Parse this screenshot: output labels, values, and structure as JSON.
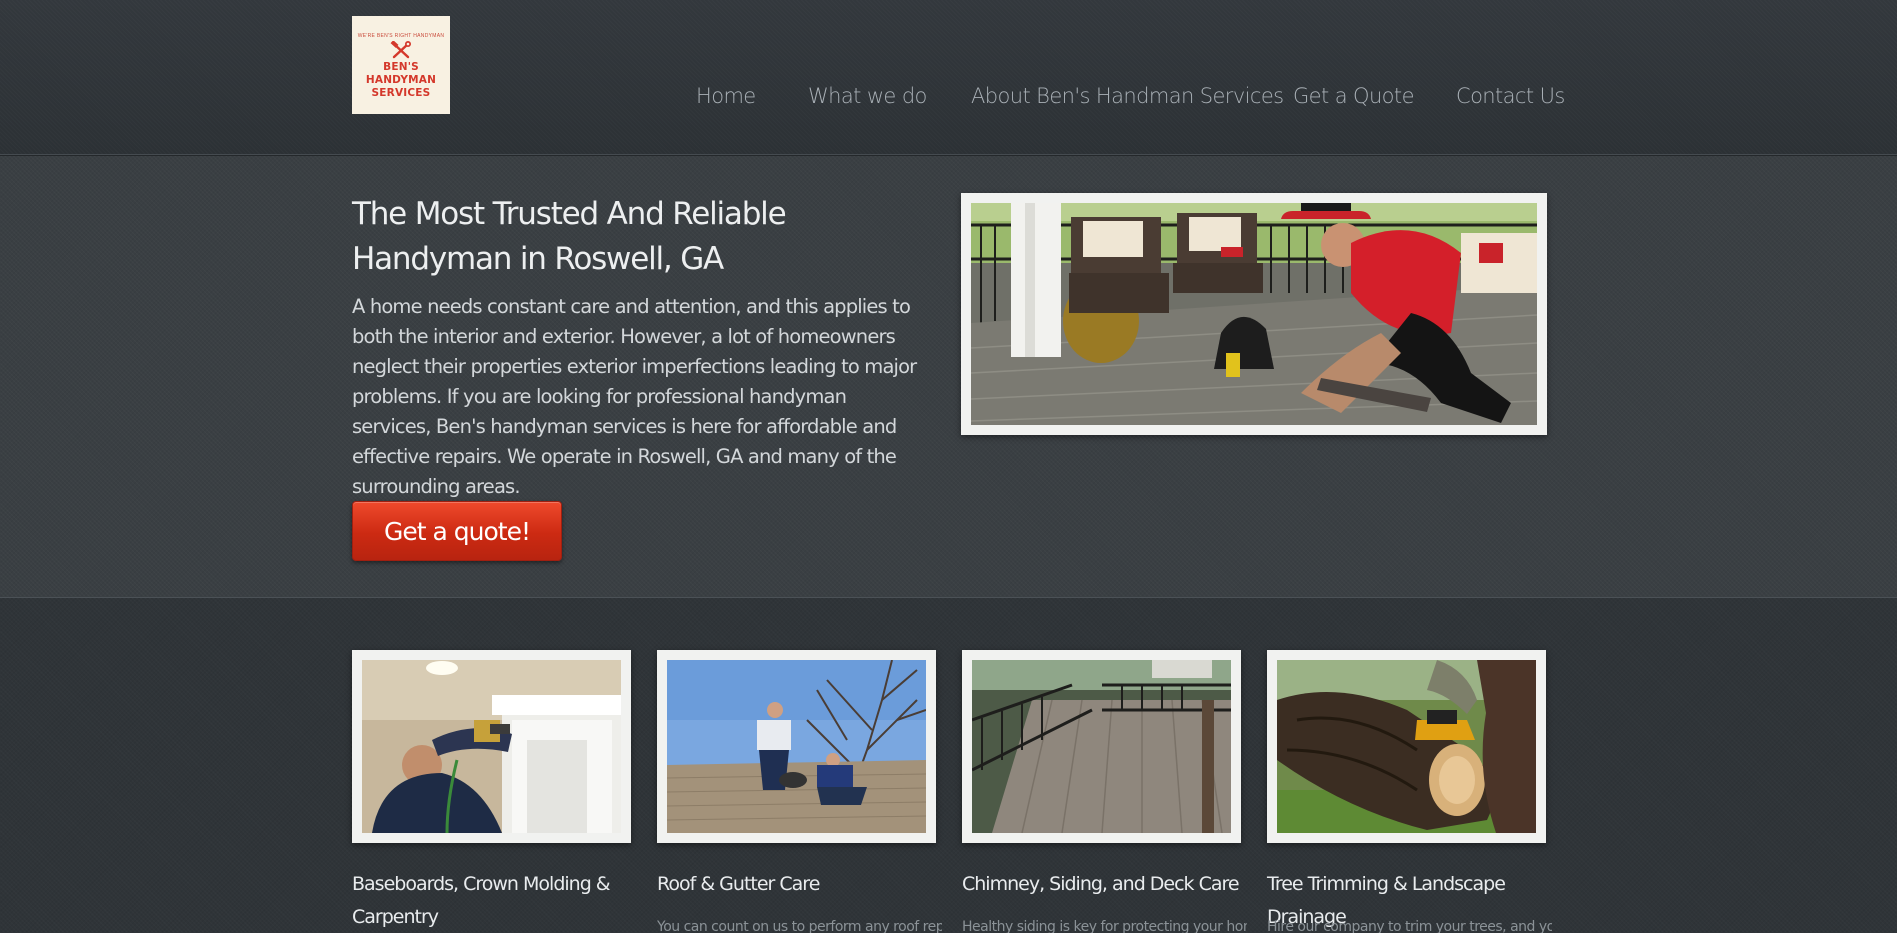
{
  "logo": {
    "arc_text": "WE'RE BEN'S RIGHT HANDYMAN",
    "line1": "BEN'S",
    "line2": "HANDYMAN",
    "line3": "SERVICES",
    "icon": "hammer-wrench-icon"
  },
  "nav": {
    "items": [
      "Home",
      "What we do",
      "About Ben's Handman Services",
      "Get a Quote",
      "Contact Us"
    ]
  },
  "hero": {
    "title": "The Most Trusted And Reliable Handyman in Roswell, GA",
    "body": "A home needs constant care and attention, and this applies to both the interior and exterior. However, a lot of homeowners neglect their properties exterior imperfections leading to major problems. If you are looking for professional handyman services, Ben's handyman services is here for affordable and effective repairs. We operate in Roswell, GA and many of the surrounding areas.",
    "cta": "Get a quote!"
  },
  "services": [
    {
      "title": "Baseboards, Crown Molding & Carpentry",
      "text": ""
    },
    {
      "title": "Roof & Gutter Care",
      "text": "You can count on us to perform any roof repair"
    },
    {
      "title": "Chimney, Siding, and Deck Care",
      "text": "Healthy siding is key for protecting your home."
    },
    {
      "title": "Tree Trimming & Landscape Drainage",
      "text": "Hire our company to trim your trees, and you"
    }
  ],
  "colors": {
    "accent": "#d4382b",
    "button": "#cc2a12",
    "background": "#2f3438",
    "nav_text": "#a9b0b6"
  }
}
